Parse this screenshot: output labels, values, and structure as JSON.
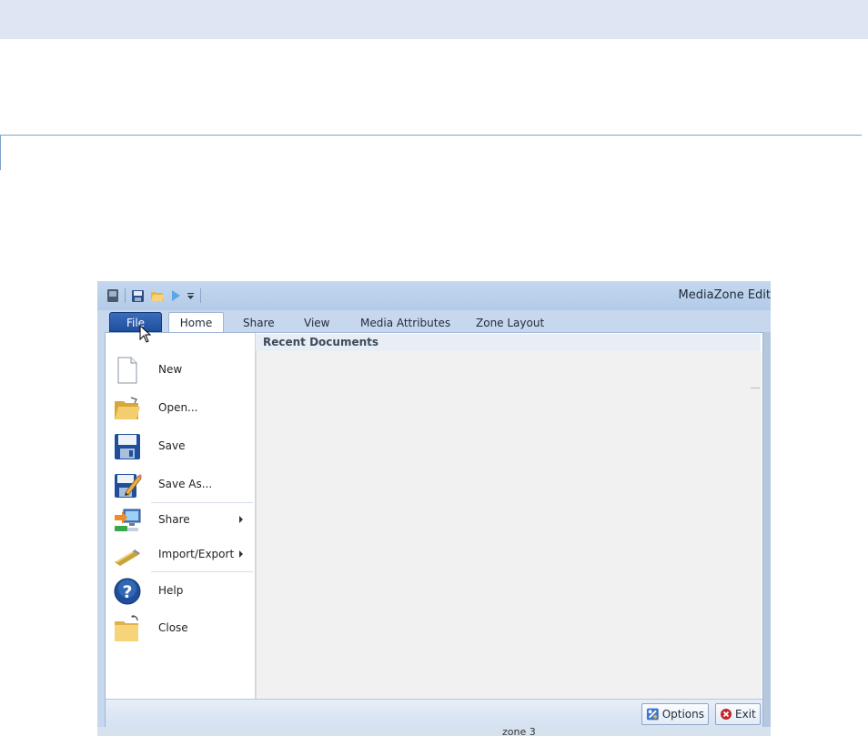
{
  "window": {
    "title": "MediaZone Edit"
  },
  "tabs": [
    {
      "label": "File"
    },
    {
      "label": "Home"
    },
    {
      "label": "Share"
    },
    {
      "label": "View"
    },
    {
      "label": "Media Attributes"
    },
    {
      "label": "Zone Layout"
    }
  ],
  "menu": {
    "items": [
      {
        "label": "New",
        "icon": "new-document-icon"
      },
      {
        "label": "Open...",
        "icon": "open-folder-icon"
      },
      {
        "label": "Save",
        "icon": "save-icon"
      },
      {
        "label": "Save As...",
        "icon": "save-as-icon"
      },
      {
        "label": "Share",
        "icon": "share-icon",
        "submenu": true
      },
      {
        "label": "Import/Export",
        "icon": "import-export-icon",
        "submenu": true
      },
      {
        "label": "Help",
        "icon": "help-icon"
      },
      {
        "label": "Close",
        "icon": "close-folder-icon"
      }
    ],
    "recent_header": "Recent Documents",
    "options_label": "Options",
    "exit_label": "Exit"
  },
  "background": {
    "zone_label": "zone 3"
  },
  "colors": {
    "file_tab": "#2a5aa8",
    "accent_border": "#7ea3cc",
    "exit_red": "#c0262d"
  }
}
